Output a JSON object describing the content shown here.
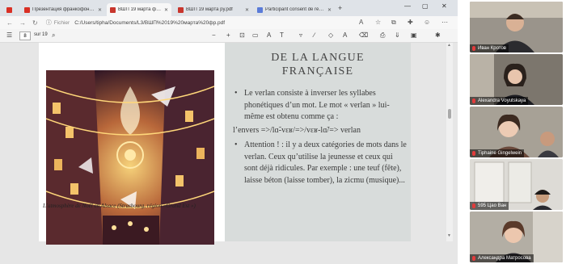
{
  "browser": {
    "tabs": [
      {
        "label": "",
        "favicon_color": "#d93025"
      },
      {
        "label": "Презентация франкофония - ...",
        "favicon_color": "#d93025"
      },
      {
        "label": "ВШП 19 марта фр.pdf",
        "favicon_color": "#c8362d"
      },
      {
        "label": "ВШП 19 марта ру.pdf",
        "favicon_color": "#c8362d"
      },
      {
        "label": "Participant consent de réunion ...",
        "favicon_color": "#5a7bd8"
      }
    ],
    "new_tab_label": "+",
    "window_controls": [
      "—",
      "▢",
      "✕"
    ],
    "address": {
      "site_label": "Fichier",
      "url": "C:/Users/tipha/Documents/L3/ВШП%2019%20марта%20фр.pdf"
    },
    "pdf_toolbar": {
      "page_current": "8",
      "page_total": "sur 19"
    }
  },
  "slide": {
    "title_line1": "DE LA LANGUE",
    "title_line2": "FRANÇAISE",
    "bullet1": "Le verlan consiste à inverser les syllabes phonétiques d’un mot. Le mot « verlan » lui-même est obtenu comme ça :",
    "transform": "l’envers =>/lɑ̃-vɛʁ/=>/vɛʁ-lɑ̃/=> verlan",
    "bullet2": "Attention ! : il y a deux catégories de mots dans le verlan. Ceux qu’utilise la jeunesse et ceux qui sont déjà ridicules. Par exemple : une teuf (fête), laisse béton (laisse tomber), la zicmu (musique)...",
    "caption": "L’atmosphère de Noël en Alsace (Strasbourg, région «Grand Est »)"
  },
  "participants": [
    {
      "name": "Иван Кротов"
    },
    {
      "name": "Alexandra Voyutskaya"
    },
    {
      "name": "Tiphaine Gingelwein"
    },
    {
      "name": "595 Цао Ван"
    },
    {
      "name": "Александра Матросова"
    }
  ]
}
